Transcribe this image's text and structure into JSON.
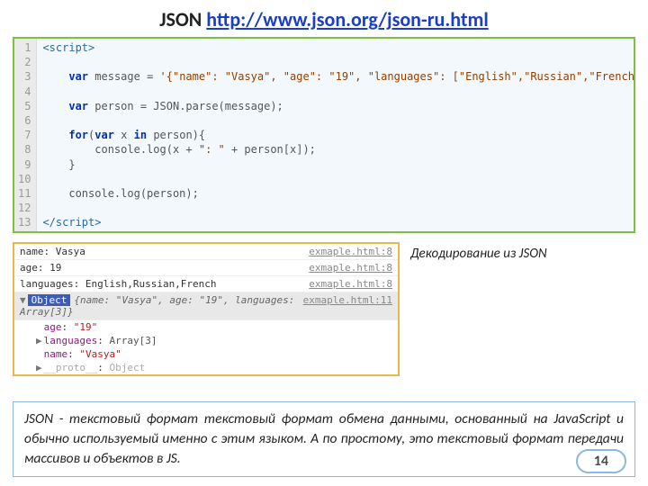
{
  "title_prefix": "JSON ",
  "title_link_text": "http://www.json.org/json-ru.html",
  "title_link_href": "http://www.json.org/json-ru.html",
  "code": {
    "lines": [
      {
        "n": "1",
        "html": "<span class='tag'>&lt;script&gt;</span>"
      },
      {
        "n": "2",
        "html": ""
      },
      {
        "n": "3",
        "html": "    <span class='kw'>var</span> message = <span class='str'>'{\"name\": \"Vasya\", \"age\": \"19\", \"languages\": [\"English\",\"Russian\",\"French\"] }'</span>;"
      },
      {
        "n": "4",
        "html": ""
      },
      {
        "n": "5",
        "html": "    <span class='kw'>var</span> person = JSON.parse(message);"
      },
      {
        "n": "6",
        "html": ""
      },
      {
        "n": "7",
        "html": "    <span class='kw'>for</span>(<span class='kw'>var</span> x <span class='kw'>in</span> person){"
      },
      {
        "n": "8",
        "html": "        console.log(x + <span class='str'>\": \"</span> + person[x]);"
      },
      {
        "n": "9",
        "html": "    }"
      },
      {
        "n": "10",
        "html": ""
      },
      {
        "n": "11",
        "html": "    console.log(person);"
      },
      {
        "n": "12",
        "html": ""
      },
      {
        "n": "13",
        "html": "<span class='tag'>&lt;/script&gt;</span>"
      }
    ]
  },
  "console": {
    "plain": [
      {
        "text": "name: Vasya",
        "src": "exmaple.html:8"
      },
      {
        "text": "age: 19",
        "src": "exmaple.html:8"
      },
      {
        "text": "languages: English,Russian,French",
        "src": "exmaple.html:8"
      }
    ],
    "object_src": "exmaple.html:11",
    "object_word": "Object",
    "object_summary": "{name: \"Vasya\", age: \"19\", languages: Array[3]}",
    "props": [
      {
        "arrow": "",
        "key": "age",
        "valclass": "propvalstr",
        "val": "\"19\""
      },
      {
        "arrow": "▶",
        "key": "languages",
        "valclass": "propvalobj",
        "val": "Array[3]"
      },
      {
        "arrow": "",
        "key": "name",
        "valclass": "propvalstr",
        "val": "\"Vasya\""
      },
      {
        "arrow": "▶",
        "key": "__proto__",
        "valclass": "proto",
        "val": "Object"
      }
    ]
  },
  "caption": "Декодирование  из JSON",
  "definition": "JSON - текстовый формат текстовый формат обмена данными, основанный на JavaScript и обычно используемый именно с этим языком. А по простому, это текстовый формат передачи массивов и объектов в JS.",
  "page": "14"
}
